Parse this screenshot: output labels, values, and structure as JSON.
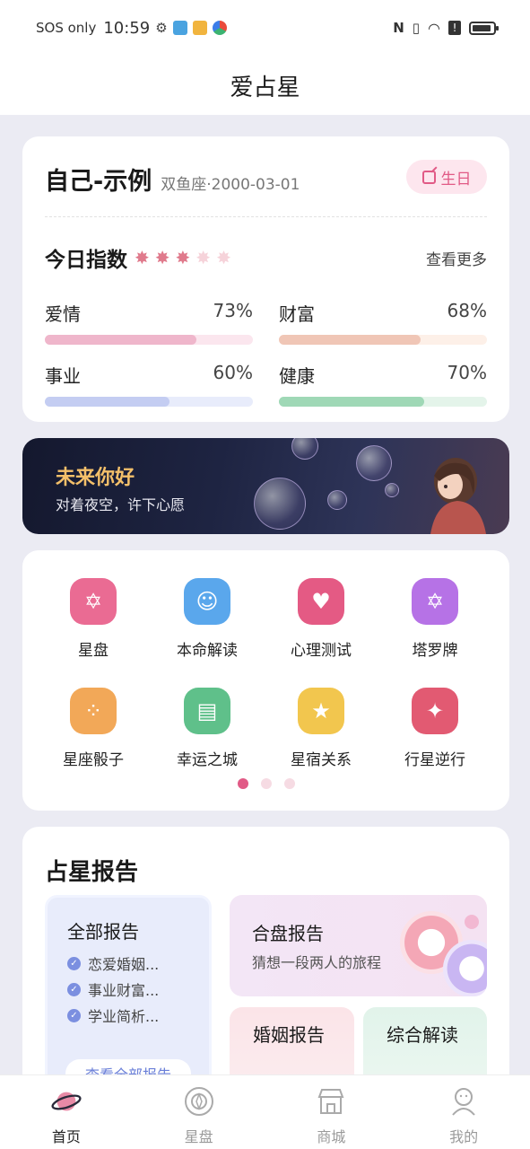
{
  "status_bar": {
    "carrier": "SOS only",
    "time": "10:59"
  },
  "header": {
    "title": "爱占星"
  },
  "profile": {
    "name": "自己-示例",
    "sign_date": "双鱼座·2000-03-01",
    "birthday_button": "生日",
    "index_title": "今日指数",
    "stars_filled": 3,
    "stars_total": 5,
    "more_link": "查看更多",
    "metrics": [
      {
        "label": "爱情",
        "value": "73%",
        "fraction": 0.73,
        "color": "#efb6cb",
        "track": "#fbe6ee"
      },
      {
        "label": "财富",
        "value": "68%",
        "fraction": 0.68,
        "color": "#f0c6b6",
        "track": "#fdf0e8"
      },
      {
        "label": "事业",
        "value": "60%",
        "fraction": 0.6,
        "color": "#c4cdf2",
        "track": "#e8ecfb"
      },
      {
        "label": "健康",
        "value": "70%",
        "fraction": 0.7,
        "color": "#9fd8b6",
        "track": "#e4f4ea"
      }
    ]
  },
  "banner": {
    "title": "未来你好",
    "subtitle": "对着夜空，许下心愿"
  },
  "tools": {
    "items": [
      {
        "label": "星盘",
        "icon": "astrolabe-icon",
        "color": "#ea6b93"
      },
      {
        "label": "本命解读",
        "icon": "person-card-icon",
        "color": "#5aa7ec"
      },
      {
        "label": "心理测试",
        "icon": "heart-icon",
        "color": "#e45a84"
      },
      {
        "label": "塔罗牌",
        "icon": "tarot-star-icon",
        "color": "#b672e6"
      },
      {
        "label": "星座骰子",
        "icon": "dice-icon",
        "color": "#f2a858"
      },
      {
        "label": "幸运之城",
        "icon": "building-icon",
        "color": "#5fc08a"
      },
      {
        "label": "星宿关系",
        "icon": "smiling-star-icon",
        "color": "#f2c64e"
      },
      {
        "label": "行星逆行",
        "icon": "stars-icon",
        "color": "#e25a72"
      }
    ],
    "page_count": 3,
    "active_page": 1
  },
  "reports": {
    "title": "占星报告",
    "all": {
      "title": "全部报告",
      "items": [
        "恋爱婚姻...",
        "事业财富...",
        "学业简析..."
      ],
      "button": "查看全部报告"
    },
    "synastry": {
      "title": "合盘报告",
      "subtitle": "猜想一段两人的旅程"
    },
    "marriage": {
      "title": "婚姻报告"
    },
    "combined": {
      "title": "综合解读"
    }
  },
  "bottom_nav": {
    "items": [
      {
        "label": "首页",
        "icon": "planet-icon",
        "active": true
      },
      {
        "label": "星盘",
        "icon": "astrolabe-icon",
        "active": false
      },
      {
        "label": "商城",
        "icon": "shop-icon",
        "active": false
      },
      {
        "label": "我的",
        "icon": "user-icon",
        "active": false
      }
    ]
  }
}
